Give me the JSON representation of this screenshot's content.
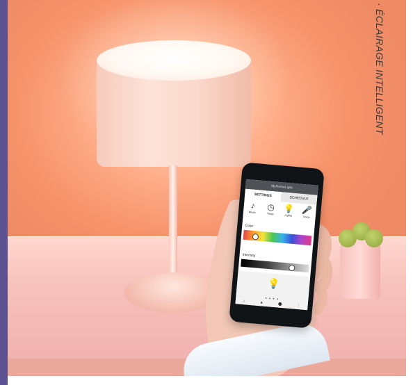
{
  "side_title": "· ÉCLAIRAGE INTELLIGENT",
  "phone": {
    "app_title": "MyHomeLight",
    "tabs": [
      "SETTINGS",
      "SCHEDULE"
    ],
    "icons": [
      {
        "name": "music-icon",
        "label": "Music",
        "glyph": "♪"
      },
      {
        "name": "timer-icon",
        "label": "Timer",
        "glyph": "◷"
      },
      {
        "name": "bulb-icon",
        "label": "Lights",
        "glyph": "💡"
      },
      {
        "name": "mic-icon",
        "label": "Voice",
        "glyph": "🎤"
      }
    ],
    "color_label": "Color",
    "intensity_label": "Intensity",
    "bulb_glyph": "💡",
    "dots": "● ● ● ●",
    "nav": [
      "⌂",
      "▲",
      "⬤",
      "⋮"
    ]
  }
}
